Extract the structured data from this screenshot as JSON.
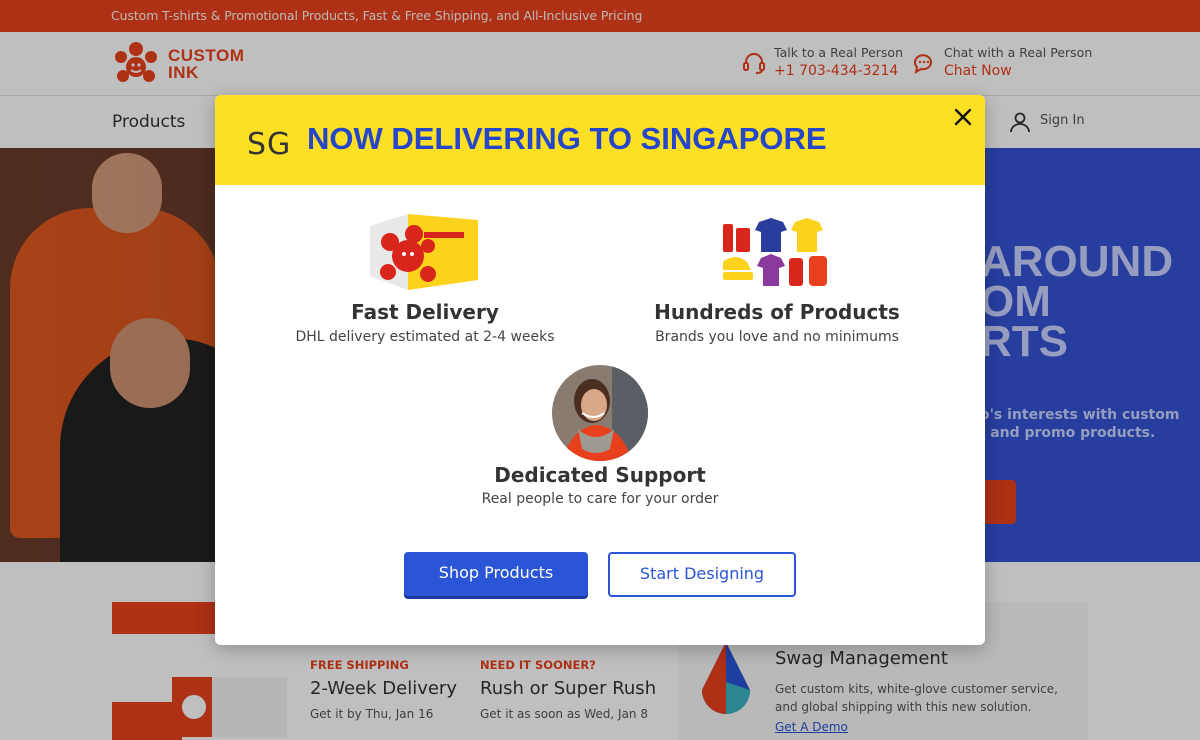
{
  "top_banner": {
    "text": "Custom T-shirts & Promotional Products, Fast & Free Shipping, and All-Inclusive Pricing"
  },
  "header": {
    "logo_text_line1": "CUSTOM",
    "logo_text_line2": "INK",
    "phone": {
      "label": "Talk to a Real Person",
      "value": "+1 703-434-3214",
      "icon": "headset-icon"
    },
    "chat": {
      "label": "Chat with a Real Person",
      "value": "Chat Now",
      "icon": "chat-bubble-icon"
    }
  },
  "nav": {
    "products_label": "Products",
    "signin_label": "Sign In"
  },
  "hero": {
    "headline_1": "AROUND",
    "headline_2": "OM",
    "headline_3": "RTS",
    "sub_1": "o's interests with custom",
    "sub_2": ", and promo products."
  },
  "lower": {
    "col1": {
      "tag": "FREE SHIPPING",
      "heading": "2-Week Delivery",
      "desc": "Get it by Thu, Jan 16"
    },
    "col2": {
      "tag": "NEED IT SOONER?",
      "heading": "Rush or Super Rush",
      "desc": "Get it as soon as Wed, Jan 8"
    },
    "swag": {
      "heading": "Swag Management",
      "desc": "Get custom kits, white-glove customer service, and global shipping with this new solution.",
      "link": "Get A Demo"
    }
  },
  "modal": {
    "country_code": "SG",
    "title": "NOW DELIVERING TO SINGAPORE",
    "close_icon": "close-icon",
    "features": [
      {
        "title": "Fast Delivery",
        "desc": "DHL delivery estimated at 2-4 weeks",
        "icon": "dhl-box-icon"
      },
      {
        "title": "Hundreds of Products",
        "desc": "Brands you love and no minimums",
        "icon": "products-grid-icon"
      },
      {
        "title": "Dedicated Support",
        "desc": "Real people to care for your order",
        "icon": "support-agent-avatar"
      }
    ],
    "primary_button": "Shop Products",
    "secondary_button": "Start Designing"
  },
  "colors": {
    "brand_orange": "#e8401c",
    "modal_yellow": "#fde024",
    "title_blue": "#2546c8",
    "button_blue": "#2a55d6"
  }
}
